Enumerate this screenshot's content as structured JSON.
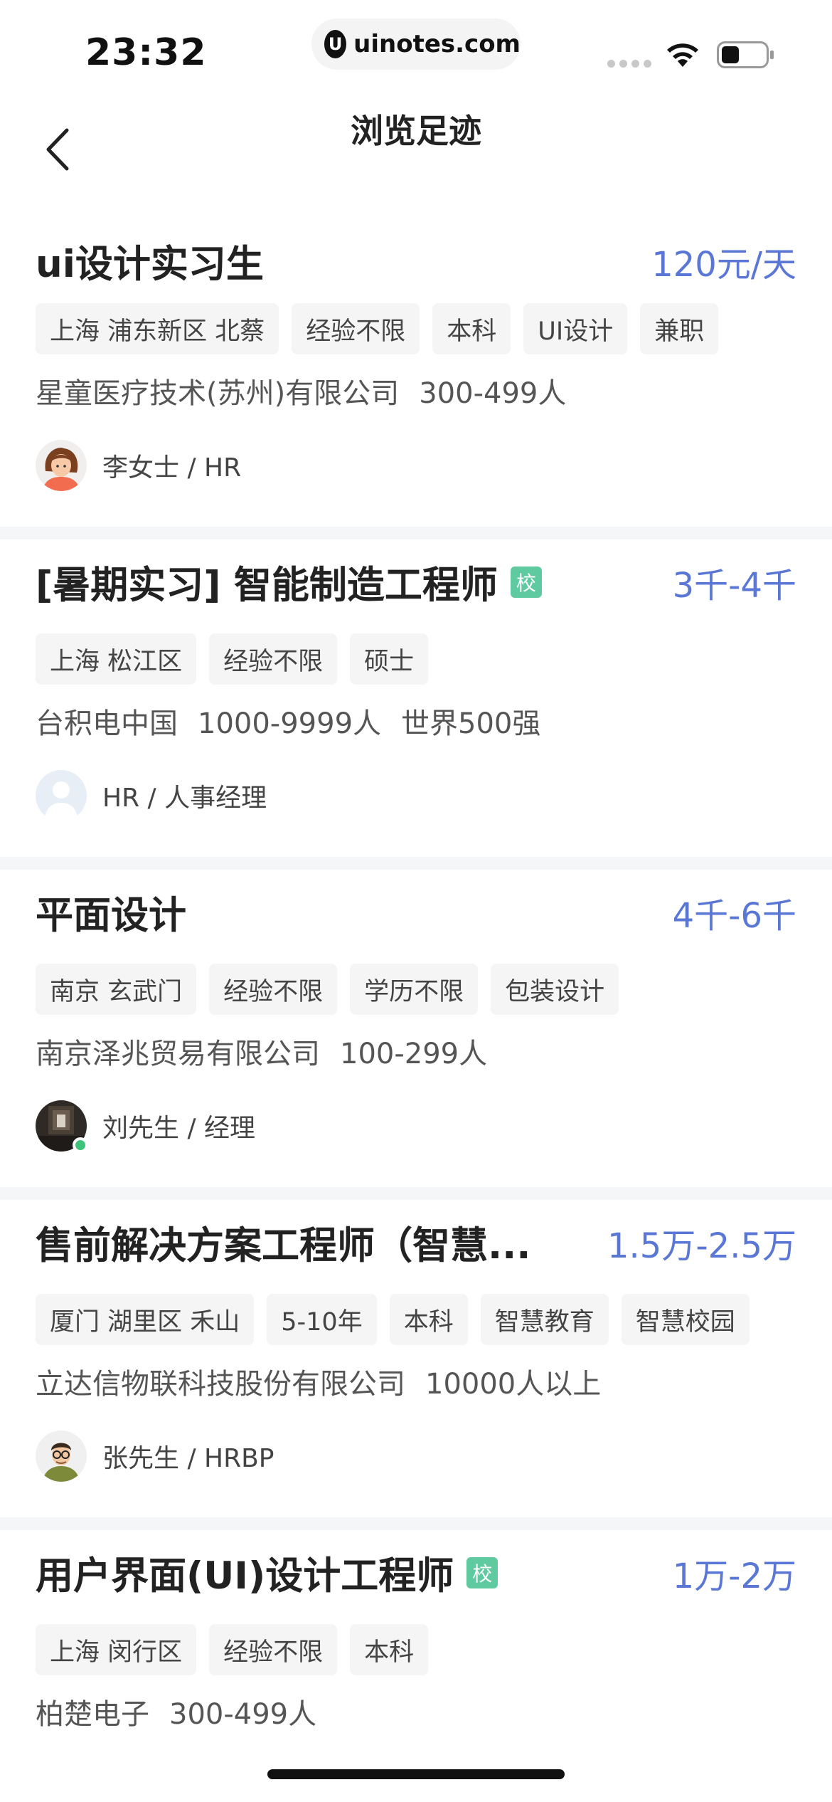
{
  "status_bar": {
    "time": "23:32",
    "url": "uinotes.com",
    "url_logo_letter": "U"
  },
  "nav": {
    "title": "浏览足迹",
    "back_icon": "chevron-left-icon"
  },
  "colors": {
    "salary": "#5a77d6",
    "school_badge": "#5fc9a0",
    "online": "#3ec47a"
  },
  "jobs": [
    {
      "title": "ui设计实习生",
      "school": "",
      "salary": "120元/天",
      "tags": [
        "上海 浦东新区 北蔡",
        "经验不限",
        "本科",
        "UI设计",
        "兼职"
      ],
      "company": [
        "星童医疗技术(苏州)有限公司",
        "300-499人"
      ],
      "hr": "李女士 / HR",
      "online": false,
      "avatar": "female-cartoon"
    },
    {
      "title": "[暑期实习] 智能制造工程师",
      "school": "校",
      "salary": "3千-4千",
      "tags": [
        "上海 松江区",
        "经验不限",
        "硕士"
      ],
      "company": [
        "台积电中国",
        "1000-9999人",
        "世界500强"
      ],
      "hr": "HR / 人事经理",
      "online": false,
      "avatar": "default-placeholder"
    },
    {
      "title": "平面设计",
      "school": "",
      "salary": "4千-6千",
      "tags": [
        "南京 玄武门",
        "经验不限",
        "学历不限",
        "包装设计"
      ],
      "company": [
        "南京泽兆贸易有限公司",
        "100-299人"
      ],
      "hr": "刘先生 / 经理",
      "online": true,
      "avatar": "dark-photo"
    },
    {
      "title": "售前解决方案工程师（智慧...",
      "school": "",
      "salary": "1.5万-2.5万",
      "tags": [
        "厦门 湖里区 禾山",
        "5-10年",
        "本科",
        "智慧教育",
        "智慧校园"
      ],
      "company": [
        "立达信物联科技股份有限公司",
        "10000人以上"
      ],
      "hr": "张先生 / HRBP",
      "online": false,
      "avatar": "male-cartoon"
    },
    {
      "title": "用户界面(UI)设计工程师",
      "school": "校",
      "salary": "1万-2万",
      "tags": [
        "上海 闵行区",
        "经验不限",
        "本科"
      ],
      "company": [
        "柏楚电子",
        "300-499人"
      ],
      "hr": "",
      "online": false,
      "avatar": ""
    }
  ]
}
